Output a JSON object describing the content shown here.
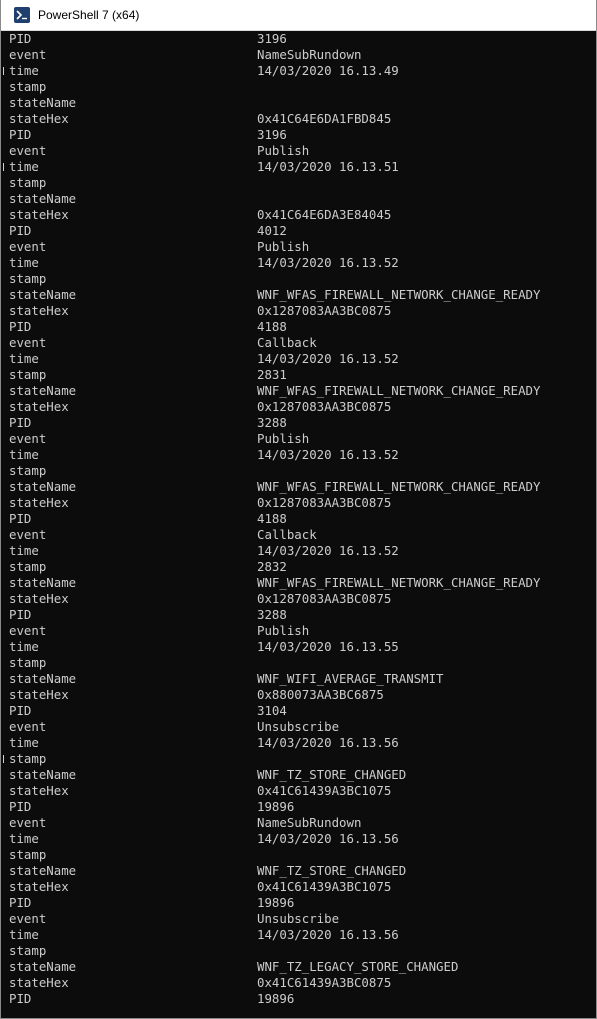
{
  "window": {
    "title": "PowerShell 7 (x64)",
    "icon": "powershell-icon"
  },
  "console": {
    "rows": [
      {
        "key": "PID",
        "value": "3196"
      },
      {
        "key": "event",
        "value": "NameSubRundown"
      },
      {
        "key": "time",
        "value": "14/03/2020 16.13.49"
      },
      {
        "key": "stamp",
        "value": ""
      },
      {
        "key": "stateName",
        "value": ""
      },
      {
        "key": "stateHex",
        "value": "0x41C64E6DA1FBD845"
      },
      {
        "key": "PID",
        "value": "3196"
      },
      {
        "key": "event",
        "value": "Publish"
      },
      {
        "key": "time",
        "value": "14/03/2020 16.13.51"
      },
      {
        "key": "stamp",
        "value": ""
      },
      {
        "key": "stateName",
        "value": ""
      },
      {
        "key": "stateHex",
        "value": "0x41C64E6DA3E84045"
      },
      {
        "key": "PID",
        "value": "4012"
      },
      {
        "key": "event",
        "value": "Publish"
      },
      {
        "key": "time",
        "value": "14/03/2020 16.13.52"
      },
      {
        "key": "stamp",
        "value": ""
      },
      {
        "key": "stateName",
        "value": "WNF_WFAS_FIREWALL_NETWORK_CHANGE_READY"
      },
      {
        "key": "stateHex",
        "value": "0x1287083AA3BC0875"
      },
      {
        "key": "PID",
        "value": "4188"
      },
      {
        "key": "event",
        "value": "Callback"
      },
      {
        "key": "time",
        "value": "14/03/2020 16.13.52"
      },
      {
        "key": "stamp",
        "value": "2831"
      },
      {
        "key": "stateName",
        "value": "WNF_WFAS_FIREWALL_NETWORK_CHANGE_READY"
      },
      {
        "key": "stateHex",
        "value": "0x1287083AA3BC0875"
      },
      {
        "key": "PID",
        "value": "3288"
      },
      {
        "key": "event",
        "value": "Publish"
      },
      {
        "key": "time",
        "value": "14/03/2020 16.13.52"
      },
      {
        "key": "stamp",
        "value": ""
      },
      {
        "key": "stateName",
        "value": "WNF_WFAS_FIREWALL_NETWORK_CHANGE_READY"
      },
      {
        "key": "stateHex",
        "value": "0x1287083AA3BC0875"
      },
      {
        "key": "PID",
        "value": "4188"
      },
      {
        "key": "event",
        "value": "Callback"
      },
      {
        "key": "time",
        "value": "14/03/2020 16.13.52"
      },
      {
        "key": "stamp",
        "value": "2832"
      },
      {
        "key": "stateName",
        "value": "WNF_WFAS_FIREWALL_NETWORK_CHANGE_READY"
      },
      {
        "key": "stateHex",
        "value": "0x1287083AA3BC0875"
      },
      {
        "key": "PID",
        "value": "3288"
      },
      {
        "key": "event",
        "value": "Publish"
      },
      {
        "key": "time",
        "value": "14/03/2020 16.13.55"
      },
      {
        "key": "stamp",
        "value": ""
      },
      {
        "key": "stateName",
        "value": "WNF_WIFI_AVERAGE_TRANSMIT"
      },
      {
        "key": "stateHex",
        "value": "0x880073AA3BC6875"
      },
      {
        "key": "PID",
        "value": "3104"
      },
      {
        "key": "event",
        "value": "Unsubscribe"
      },
      {
        "key": "time",
        "value": "14/03/2020 16.13.56"
      },
      {
        "key": "stamp",
        "value": ""
      },
      {
        "key": "stateName",
        "value": "WNF_TZ_STORE_CHANGED"
      },
      {
        "key": "stateHex",
        "value": "0x41C61439A3BC1075"
      },
      {
        "key": "PID",
        "value": "19896"
      },
      {
        "key": "event",
        "value": "NameSubRundown"
      },
      {
        "key": "time",
        "value": "14/03/2020 16.13.56"
      },
      {
        "key": "stamp",
        "value": ""
      },
      {
        "key": "stateName",
        "value": "WNF_TZ_STORE_CHANGED"
      },
      {
        "key": "stateHex",
        "value": "0x41C61439A3BC1075"
      },
      {
        "key": "PID",
        "value": "19896"
      },
      {
        "key": "event",
        "value": "Unsubscribe"
      },
      {
        "key": "time",
        "value": "14/03/2020 16.13.56"
      },
      {
        "key": "stamp",
        "value": ""
      },
      {
        "key": "stateName",
        "value": "WNF_TZ_LEGACY_STORE_CHANGED"
      },
      {
        "key": "stateHex",
        "value": "0x41C61439A3BC0875"
      },
      {
        "key": "PID",
        "value": "19896"
      }
    ]
  }
}
